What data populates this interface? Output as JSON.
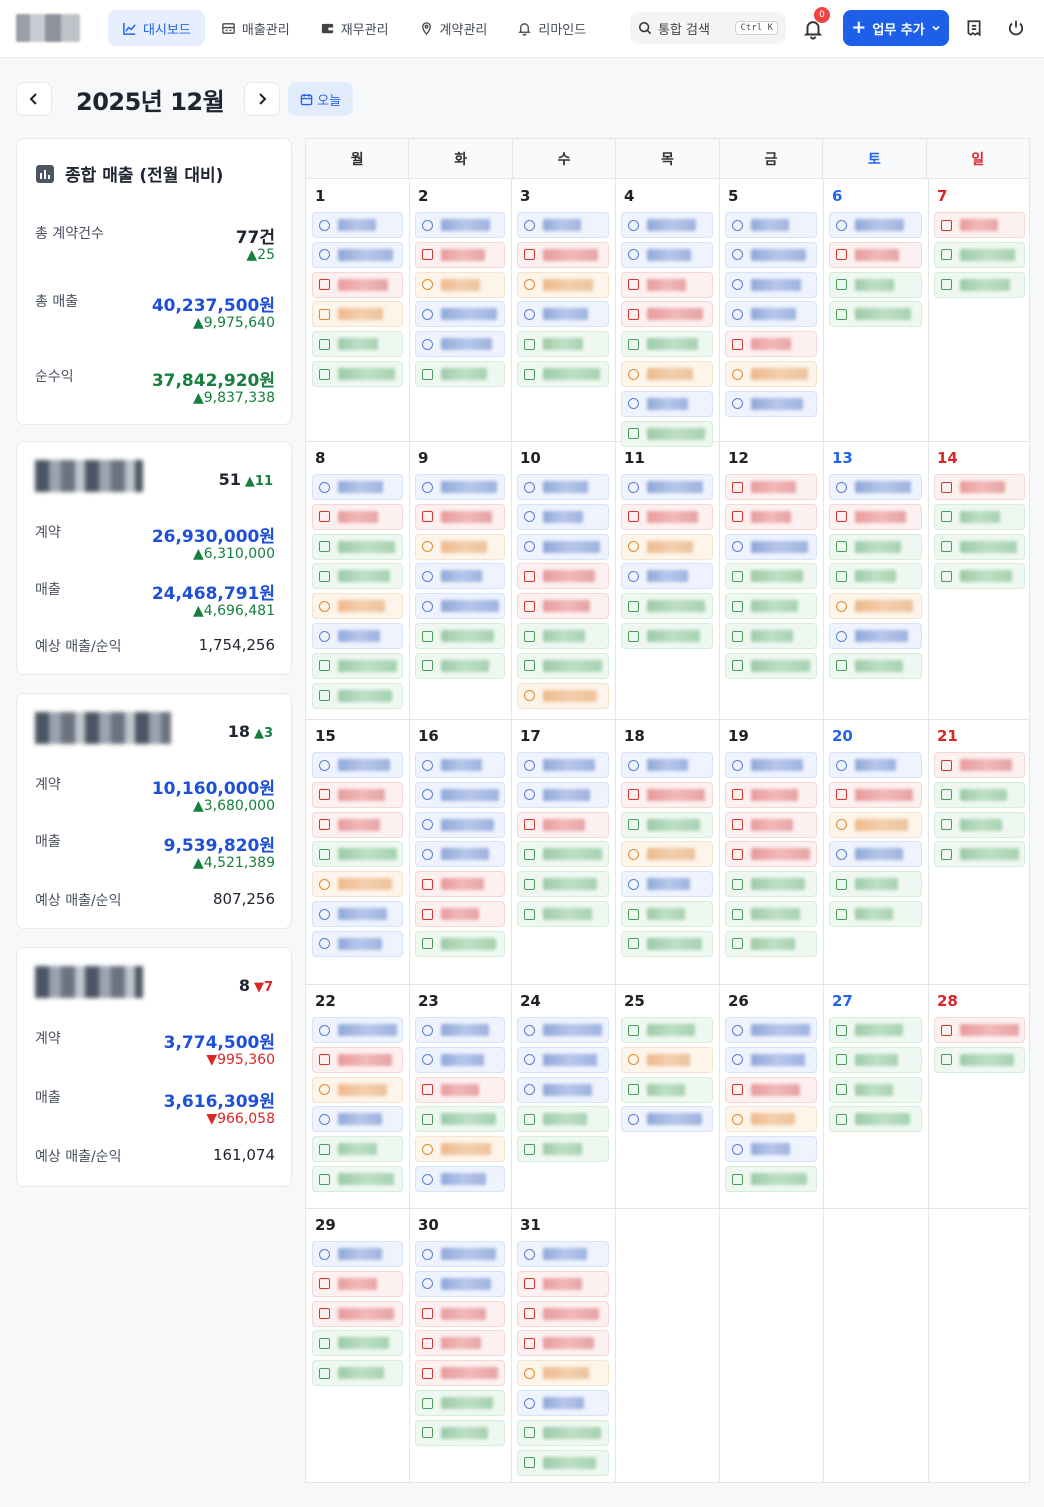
{
  "nav": {
    "items": [
      {
        "label": "대시보드",
        "icon": "chart-line-icon",
        "active": true
      },
      {
        "label": "매출관리",
        "icon": "receipt-icon",
        "active": false
      },
      {
        "label": "재무관리",
        "icon": "wallet-icon",
        "active": false
      },
      {
        "label": "계약관리",
        "icon": "pin-icon",
        "active": false
      },
      {
        "label": "리마인드",
        "icon": "bell-icon",
        "active": false
      }
    ]
  },
  "search": {
    "label": "통합 검색",
    "shortcut": "Ctrl K"
  },
  "notifications": {
    "count": "0"
  },
  "add_button": {
    "label": "업무 추가"
  },
  "calendar_header": {
    "month_label": "2025년 12월",
    "today_label": "오늘"
  },
  "summary": {
    "title": "종합 매출 (전월 대비)",
    "contracts_label": "총 계약건수",
    "contracts_value": "77건",
    "contracts_delta": "▲25",
    "revenue_label": "총 매출",
    "revenue_value": "40,237,500원",
    "revenue_delta": "▲9,975,640",
    "profit_label": "순수익",
    "profit_value": "37,842,920원",
    "profit_delta": "▲9,837,338"
  },
  "staff": [
    {
      "count": "51",
      "count_delta": "▲11",
      "delta_dir": "up",
      "contract_label": "계약",
      "contract_value": "26,930,000원",
      "contract_delta": "▲6,310,000",
      "sales_label": "매출",
      "sales_value": "24,468,791원",
      "sales_delta": "▲4,696,481",
      "forecast_label": "예상 매출/순익",
      "forecast_value": "1,754,256"
    },
    {
      "count": "18",
      "count_delta": "▲3",
      "delta_dir": "up",
      "contract_label": "계약",
      "contract_value": "10,160,000원",
      "contract_delta": "▲3,680,000",
      "sales_label": "매출",
      "sales_value": "9,539,820원",
      "sales_delta": "▲4,521,389",
      "forecast_label": "예상 매출/순익",
      "forecast_value": "807,256"
    },
    {
      "count": "8",
      "count_delta": "▼7",
      "delta_dir": "down",
      "contract_label": "계약",
      "contract_value": "3,774,500원",
      "contract_delta": "▼995,360",
      "sales_label": "매출",
      "sales_value": "3,616,309원",
      "sales_delta": "▼966,058",
      "forecast_label": "예상 매출/순익",
      "forecast_value": "161,074"
    }
  ],
  "weekdays": [
    "월",
    "화",
    "수",
    "목",
    "금",
    "토",
    "일"
  ],
  "weeks": [
    {
      "days": [
        {
          "num": "1",
          "events": [
            "done",
            "done",
            "urgent",
            "warn",
            "todo",
            "todo"
          ]
        },
        {
          "num": "2",
          "events": [
            "done",
            "urgent",
            "pend",
            "done",
            "done",
            "todo"
          ]
        },
        {
          "num": "3",
          "events": [
            "done",
            "urgent",
            "pend",
            "done",
            "todo",
            "todo"
          ]
        },
        {
          "num": "4",
          "events": [
            "done",
            "done",
            "urgent",
            "urgent",
            "todo",
            "pend",
            "done",
            "todo"
          ]
        },
        {
          "num": "5",
          "events": [
            "done",
            "done",
            "done",
            "done",
            "urgent",
            "pend",
            "done"
          ]
        },
        {
          "num": "6",
          "events": [
            "done",
            "urgent",
            "todo",
            "todo"
          ]
        },
        {
          "num": "7",
          "events": [
            "urgent",
            "todo",
            "todo"
          ]
        }
      ]
    },
    {
      "days": [
        {
          "num": "8",
          "events": [
            "done",
            "urgent",
            "todo",
            "todo",
            "pend",
            "done",
            "todo",
            "todo"
          ]
        },
        {
          "num": "9",
          "events": [
            "done",
            "urgent",
            "pend",
            "done",
            "done",
            "todo",
            "todo"
          ]
        },
        {
          "num": "10",
          "events": [
            "done",
            "done",
            "done",
            "urgent",
            "urgent",
            "todo",
            "todo",
            "pend"
          ]
        },
        {
          "num": "11",
          "events": [
            "done",
            "urgent",
            "pend",
            "done",
            "todo",
            "todo"
          ]
        },
        {
          "num": "12",
          "events": [
            "urgent",
            "urgent",
            "done",
            "todo",
            "todo",
            "todo",
            "todo"
          ]
        },
        {
          "num": "13",
          "events": [
            "done",
            "urgent",
            "todo",
            "todo",
            "pend",
            "done",
            "todo"
          ]
        },
        {
          "num": "14",
          "events": [
            "urgent",
            "todo",
            "todo",
            "todo"
          ]
        }
      ]
    },
    {
      "days": [
        {
          "num": "15",
          "events": [
            "done",
            "urgent",
            "urgent",
            "todo",
            "pend",
            "done",
            "done"
          ]
        },
        {
          "num": "16",
          "events": [
            "done",
            "done",
            "done",
            "done",
            "urgent",
            "urgent",
            "todo"
          ]
        },
        {
          "num": "17",
          "events": [
            "done",
            "done",
            "urgent",
            "todo",
            "todo",
            "todo"
          ]
        },
        {
          "num": "18",
          "events": [
            "done",
            "urgent",
            "todo",
            "pend",
            "done",
            "todo",
            "todo"
          ]
        },
        {
          "num": "19",
          "events": [
            "done",
            "urgent",
            "urgent",
            "urgent",
            "todo",
            "todo",
            "todo"
          ]
        },
        {
          "num": "20",
          "events": [
            "done",
            "urgent",
            "pend",
            "done",
            "todo",
            "todo"
          ]
        },
        {
          "num": "21",
          "events": [
            "urgent",
            "todo",
            "todo",
            "todo"
          ]
        }
      ]
    },
    {
      "days": [
        {
          "num": "22",
          "events": [
            "done",
            "urgent",
            "pend",
            "done",
            "todo",
            "todo"
          ]
        },
        {
          "num": "23",
          "events": [
            "done",
            "done",
            "urgent",
            "todo",
            "pend",
            "done"
          ]
        },
        {
          "num": "24",
          "events": [
            "done",
            "done",
            "done",
            "todo",
            "todo"
          ]
        },
        {
          "num": "25",
          "events": [
            "todo",
            "pend",
            "todo",
            "done"
          ]
        },
        {
          "num": "26",
          "events": [
            "done",
            "done",
            "urgent",
            "pend",
            "done",
            "todo"
          ]
        },
        {
          "num": "27",
          "events": [
            "todo",
            "todo",
            "todo",
            "todo"
          ]
        },
        {
          "num": "28",
          "events": [
            "urgent",
            "todo"
          ]
        }
      ]
    },
    {
      "days": [
        {
          "num": "29",
          "events": [
            "done",
            "urgent",
            "urgent",
            "todo",
            "todo"
          ]
        },
        {
          "num": "30",
          "events": [
            "done",
            "done",
            "urgent",
            "urgent",
            "urgent",
            "todo",
            "todo"
          ]
        },
        {
          "num": "31",
          "events": [
            "done",
            "urgent",
            "urgent",
            "urgent",
            "pend",
            "done",
            "todo",
            "todo"
          ]
        },
        {
          "num": "",
          "events": []
        },
        {
          "num": "",
          "events": []
        },
        {
          "num": "",
          "events": []
        },
        {
          "num": "",
          "events": []
        }
      ]
    }
  ]
}
